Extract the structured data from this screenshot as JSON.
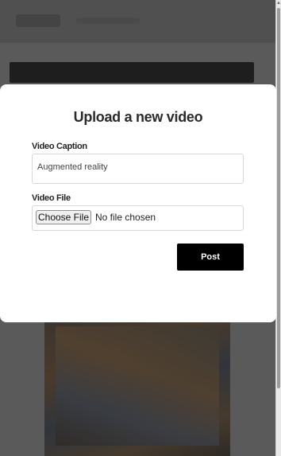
{
  "modal": {
    "title": "Upload a new video",
    "caption_label": "Video Caption",
    "caption_value": "Augmented reality",
    "file_label": "Video File",
    "choose_file_label": "Choose File",
    "no_file_text": "No file chosen",
    "post_label": "Post"
  },
  "colors": {
    "overlay": "#3f3f3f",
    "modal_bg": "#ffffff",
    "post_button_bg": "#000000",
    "post_button_text": "#ffffff"
  },
  "scrollbar": {
    "up_arrow_icon": "triangle-up"
  }
}
